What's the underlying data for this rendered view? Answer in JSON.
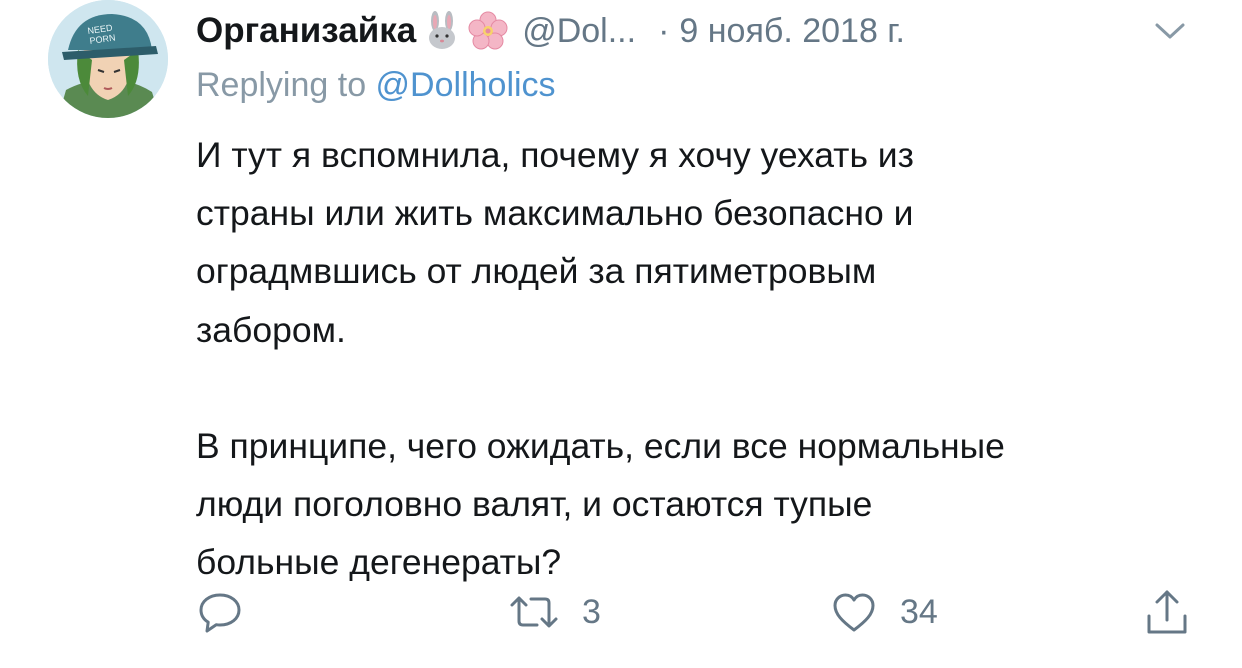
{
  "tweet": {
    "display_name": "Организайка",
    "emoji_1": "rabbit-face-icon",
    "emoji_2": "cherry-blossom-icon",
    "handle": "@Dol...",
    "separator": "·",
    "date": "9 нояб. 2018 г.",
    "reply_prefix": "Replying to ",
    "reply_mention": "@Dollholics",
    "body_paragraph_1": "И тут я вспомнила, почему я хочу уехать из\nстраны или жить максимально безопасно и\nоградмвшись от людей за пятиметровым\nзабором.",
    "body_paragraph_2": "В принципе, чего ожидать, если все нормальные\nлюди поголовно валят, и остаются тупые\nбольные дегенераты?",
    "avatar_cap_text": "NEED PORN"
  },
  "actions": {
    "reply_count": "",
    "retweet_count": "3",
    "like_count": "34"
  },
  "colors": {
    "text_primary": "#14171a",
    "text_secondary": "#657786",
    "link": "#4f93cf",
    "icon": "#657786"
  }
}
